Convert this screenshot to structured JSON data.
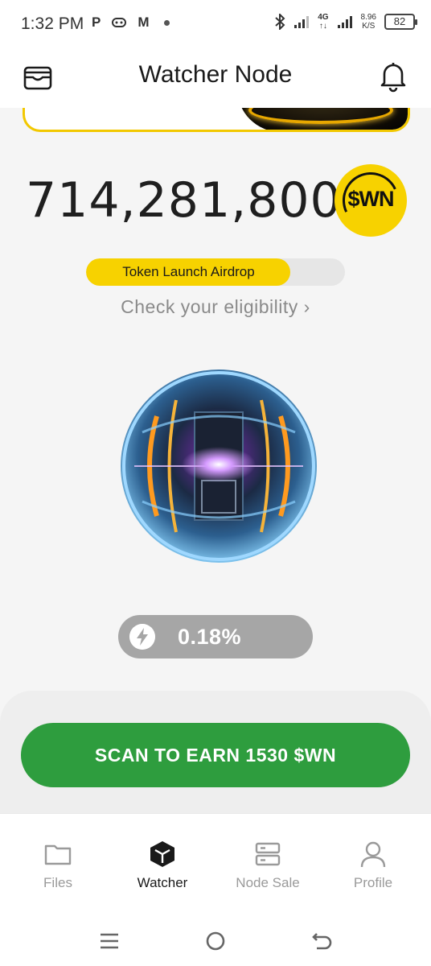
{
  "status_bar": {
    "time": "1:32 PM",
    "notification_icons": [
      "P",
      "game-controller-icon",
      "M"
    ],
    "network": "4G",
    "net_speed": "8.96",
    "net_speed_unit": "K/S",
    "battery": "82"
  },
  "header": {
    "title": "Watcher Node",
    "left_icon": "wallet-icon",
    "right_icon": "bell-icon"
  },
  "balance": {
    "amount": "714,281,800",
    "token": "$WN"
  },
  "airdrop": {
    "label": "Token Launch Airdrop",
    "progress": 0.79,
    "cta": "Check your eligibility ›"
  },
  "boost": {
    "icon": "lightning-icon",
    "value": "0.18%"
  },
  "scan_button": {
    "label": "SCAN TO EARN 1530 $WN"
  },
  "bottom_nav": {
    "items": [
      {
        "label": "Files",
        "icon": "folder-icon",
        "active": false
      },
      {
        "label": "Watcher",
        "icon": "cube-icon",
        "active": true
      },
      {
        "label": "Node Sale",
        "icon": "server-icon",
        "active": false
      },
      {
        "label": "Profile",
        "icon": "person-icon",
        "active": false
      }
    ]
  },
  "colors": {
    "accent_yellow": "#f7d200",
    "scan_green": "#2e9d3e",
    "pill_gray": "#a6a6a6"
  }
}
